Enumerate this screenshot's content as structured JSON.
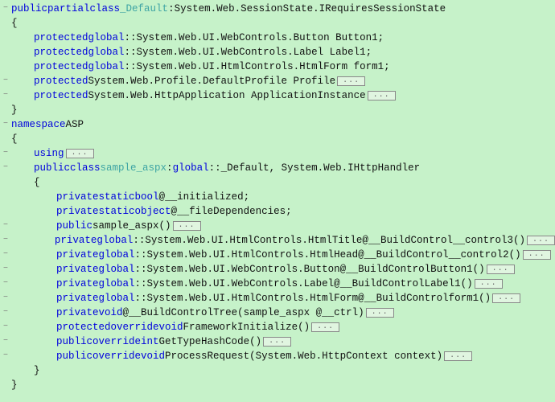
{
  "kw": {
    "public": "public",
    "partial": "partial",
    "class": "class",
    "protected": "protected",
    "global": "global",
    "namespace": "namespace",
    "using": "using",
    "private": "private",
    "static": "static",
    "bool": "bool",
    "object": "object",
    "void": "void",
    "override": "override",
    "int": "int"
  },
  "txt": {
    "colon": " : ",
    "dcolon": "::",
    "sp": " ",
    "obrace": "{",
    "cbrace": "}",
    "sc": ";",
    "parens": "()",
    "at": " @",
    "fold": "..."
  },
  "types": {
    "Default": "_Default",
    "sample_aspx": "sample_aspx"
  },
  "members": {
    "btn": "System.Web.UI.WebControls.Button Button1",
    "lbl": "System.Web.UI.WebControls.Label Label1",
    "form": "System.Web.UI.HtmlControls.HtmlForm form1",
    "profile": "System.Web.Profile.DefaultProfile Profile",
    "appinst": "System.Web.HttpApplication ApplicationInstance"
  },
  "ns": {
    "ASP": "ASP"
  },
  "class2": {
    "inherits": "_Default, System.Web.IHttpHandler",
    "fld_init": "__initialized",
    "fld_filedep": "__fileDependencies",
    "ctor": "sample_aspx",
    "m1_ret": "System.Web.UI.HtmlControls.HtmlTitle",
    "m1_name": "__BuildControl__control3",
    "m2_ret": "System.Web.UI.HtmlControls.HtmlHead",
    "m2_name": "__BuildControl__control2",
    "m3_ret": "System.Web.UI.WebControls.Button",
    "m3_name": "__BuildControlButton1",
    "m4_ret": "System.Web.UI.WebControls.Label",
    "m4_name": "__BuildControlLabel1",
    "m5_ret": "System.Web.UI.HtmlControls.HtmlForm",
    "m5_name": "__BuildControlform1",
    "m6": "__BuildControlTree(sample_aspx @__ctrl)",
    "m7": "FrameworkInitialize",
    "m8": "GetTypeHashCode",
    "m9": "ProcessRequest(System.Web.HttpContext context)"
  }
}
